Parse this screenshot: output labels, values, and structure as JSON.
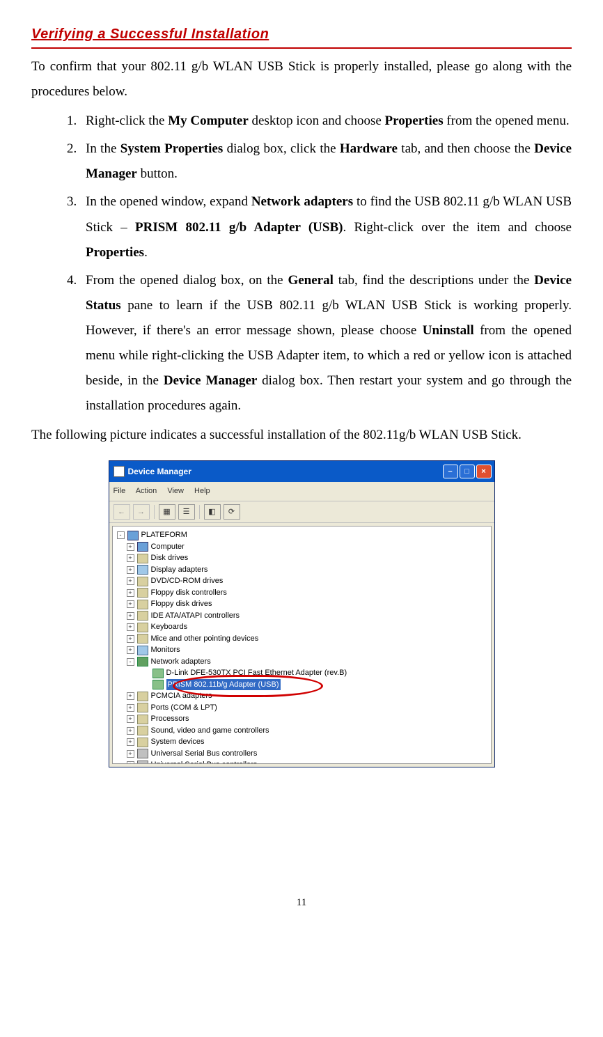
{
  "heading": "Verifying a Successful Installation",
  "intro": "To confirm that your 802.11 g/b WLAN USB Stick is properly installed, please go along with the procedures below.",
  "steps": [
    {
      "pre1": "Right-click the ",
      "b1": "My Computer",
      "mid1": " desktop icon and choose ",
      "b2": "Properties",
      "post1": " from the opened menu."
    },
    {
      "pre1": "In the ",
      "b1": "System Properties",
      "mid1": " dialog box, click the ",
      "b2": "Hardware",
      "mid2": " tab, and then choose the ",
      "b3": "Device Manager",
      "post1": " button."
    },
    {
      "pre1": "In the opened window, expand ",
      "b1": "Network adapters",
      "mid1": " to find the USB 802.11 g/b WLAN USB Stick – ",
      "b2": "PRISM 802.11 g/b Adapter (USB)",
      "mid2": ". Right-click over the item and choose ",
      "b3": "Properties",
      "post1": "."
    },
    {
      "pre1": "From the opened dialog box, on the ",
      "b1": "General",
      "mid1": " tab, find the descriptions under the ",
      "b2": "Device Status",
      "mid2": " pane to learn if the USB 802.11 g/b WLAN USB Stick is working properly. However, if there's an error message shown, please choose ",
      "b3": "Uninstall",
      "mid3": " from the opened menu while right-clicking the USB Adapter item, to which a red or yellow icon is attached beside, in the ",
      "b4": "Device Manager",
      "post1": " dialog box. Then restart your system and go through the installation procedures again."
    }
  ],
  "closing": "The following picture indicates a successful installation of the 802.11g/b WLAN USB Stick.",
  "device_manager": {
    "title": "Device Manager",
    "menus": [
      "File",
      "Action",
      "View",
      "Help"
    ],
    "root": "PLATEFORM",
    "items": [
      {
        "label": "Computer",
        "icon": "computer",
        "exp": "+"
      },
      {
        "label": "Disk drives",
        "icon": "device",
        "exp": "+"
      },
      {
        "label": "Display adapters",
        "icon": "monitor",
        "exp": "+"
      },
      {
        "label": "DVD/CD-ROM drives",
        "icon": "device",
        "exp": "+"
      },
      {
        "label": "Floppy disk controllers",
        "icon": "device",
        "exp": "+"
      },
      {
        "label": "Floppy disk drives",
        "icon": "device",
        "exp": "+"
      },
      {
        "label": "IDE ATA/ATAPI controllers",
        "icon": "device",
        "exp": "+"
      },
      {
        "label": "Keyboards",
        "icon": "device",
        "exp": "+"
      },
      {
        "label": "Mice and other pointing devices",
        "icon": "device",
        "exp": "+"
      },
      {
        "label": "Monitors",
        "icon": "monitor",
        "exp": "+"
      },
      {
        "label": "Network adapters",
        "icon": "net",
        "exp": "-",
        "children": [
          {
            "label": "D-Link DFE-530TX PCI Fast Ethernet Adapter (rev.B)",
            "icon": "card"
          },
          {
            "label": "PRISM 802.11b/g Adapter (USB)",
            "icon": "card",
            "selected": true
          }
        ]
      },
      {
        "label": "PCMCIA adapters",
        "icon": "device",
        "exp": "+"
      },
      {
        "label": "Ports (COM & LPT)",
        "icon": "device",
        "exp": "+"
      },
      {
        "label": "Processors",
        "icon": "device",
        "exp": "+"
      },
      {
        "label": "Sound, video and game controllers",
        "icon": "device",
        "exp": "+"
      },
      {
        "label": "System devices",
        "icon": "device",
        "exp": "+"
      },
      {
        "label": "Universal Serial Bus controllers",
        "icon": "usb",
        "exp": "+"
      },
      {
        "label": "Universal Serial Bus controllers",
        "icon": "usb",
        "exp": "+"
      }
    ]
  },
  "page_number": "11"
}
